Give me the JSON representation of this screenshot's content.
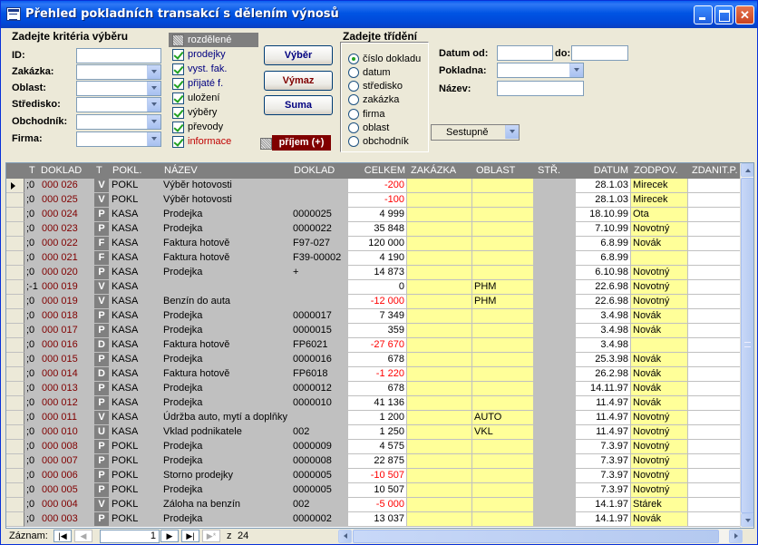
{
  "window": {
    "title": "Přehled pokladních transakcí s dělením výnosů"
  },
  "filters": {
    "title": "Zadejte kritéria výběru",
    "id_label": "ID:",
    "zakazka_label": "Zakázka:",
    "oblast_label": "Oblast:",
    "stredisko_label": "Středisko:",
    "obchodnik_label": "Obchodník:",
    "firma_label": "Firma:"
  },
  "checkboxes": [
    {
      "label": "rozdělené",
      "state": "gray"
    },
    {
      "label": "prodejky",
      "state": "on"
    },
    {
      "label": "vyst. fak.",
      "state": "on"
    },
    {
      "label": "přijaté f.",
      "state": "on"
    },
    {
      "label": "uložení",
      "state": "on"
    },
    {
      "label": "výběry",
      "state": "on"
    },
    {
      "label": "převody",
      "state": "on"
    },
    {
      "label": "informace",
      "state": "on"
    }
  ],
  "buttons": {
    "vyber": "Výběr",
    "vymaz": "Výmaz",
    "suma": "Suma",
    "prijem": "příjem (+)"
  },
  "sorting": {
    "title": "Zadejte třídění",
    "options": [
      "číslo dokladu",
      "datum",
      "středisko",
      "zakázka",
      "firma",
      "oblast",
      "obchodník"
    ],
    "selected_index": 0,
    "direction": "Sestupně"
  },
  "right_filters": {
    "datum_od_label": "Datum od:",
    "do_label": "do:",
    "pokladna_label": "Pokladna:",
    "nazev_label": "Název:"
  },
  "table": {
    "headers": [
      "T",
      "DOKLAD",
      "T",
      "POKL.",
      "NÁZEV",
      "DOKLAD",
      "CELKEM",
      "ZAKÁZKA",
      "OBLAST",
      "STŘ.",
      "DATUM",
      "ZODPOV.",
      "ZDANIT.P."
    ],
    "rows": [
      {
        "t": ";0",
        "doklad": "000 026",
        "typ": "V",
        "pokl": "POKL",
        "nazev": "Výběr hotovosti",
        "doklad2": "",
        "celkem": "-200",
        "neg": true,
        "zakazka": "",
        "oblast": "",
        "datum": "28.1.03",
        "zodpov": "Mirecek"
      },
      {
        "t": ";0",
        "doklad": "000 025",
        "typ": "V",
        "pokl": "POKL",
        "nazev": "Výběr hotovosti",
        "doklad2": "",
        "celkem": "-100",
        "neg": true,
        "zakazka": "",
        "oblast": "",
        "datum": "28.1.03",
        "zodpov": "Mirecek"
      },
      {
        "t": ";0",
        "doklad": "000 024",
        "typ": "P",
        "pokl": "KASA",
        "nazev": "Prodejka",
        "doklad2": "0000025",
        "celkem": "4 999",
        "neg": false,
        "zakazka": "",
        "oblast": "",
        "datum": "18.10.99",
        "zodpov": "Ota"
      },
      {
        "t": ";0",
        "doklad": "000 023",
        "typ": "P",
        "pokl": "KASA",
        "nazev": "Prodejka",
        "doklad2": "0000022",
        "celkem": "35 848",
        "neg": false,
        "zakazka": "",
        "oblast": "",
        "datum": "7.10.99",
        "zodpov": "Novotný"
      },
      {
        "t": ";0",
        "doklad": "000 022",
        "typ": "F",
        "pokl": "KASA",
        "nazev": "Faktura hotově",
        "doklad2": "F97-027",
        "celkem": "120 000",
        "neg": false,
        "zakazka": "",
        "oblast": "",
        "datum": "6.8.99",
        "zodpov": "Novák"
      },
      {
        "t": ";0",
        "doklad": "000 021",
        "typ": "F",
        "pokl": "KASA",
        "nazev": "Faktura hotově",
        "doklad2": "F39-00002",
        "celkem": "4 190",
        "neg": false,
        "zakazka": "",
        "oblast": "",
        "datum": "6.8.99",
        "zodpov": ""
      },
      {
        "t": ";0",
        "doklad": "000 020",
        "typ": "P",
        "pokl": "KASA",
        "nazev": "Prodejka",
        "doklad2": "+",
        "celkem": "14 873",
        "neg": false,
        "zakazka": "",
        "oblast": "",
        "datum": "6.10.98",
        "zodpov": "Novotný"
      },
      {
        "t": ";-1",
        "doklad": "000 019",
        "typ": "V",
        "pokl": "KASA",
        "nazev": "",
        "doklad2": "",
        "celkem": "0",
        "neg": false,
        "zakazka": "",
        "oblast": "PHM",
        "datum": "22.6.98",
        "zodpov": "Novotný"
      },
      {
        "t": ";0",
        "doklad": "000 019",
        "typ": "V",
        "pokl": "KASA",
        "nazev": "Benzín do auta",
        "doklad2": "",
        "celkem": "-12 000",
        "neg": true,
        "zakazka": "",
        "oblast": "PHM",
        "datum": "22.6.98",
        "zodpov": "Novotný"
      },
      {
        "t": ";0",
        "doklad": "000 018",
        "typ": "P",
        "pokl": "KASA",
        "nazev": "Prodejka",
        "doklad2": "0000017",
        "celkem": "7 349",
        "neg": false,
        "zakazka": "",
        "oblast": "",
        "datum": "3.4.98",
        "zodpov": "Novák"
      },
      {
        "t": ";0",
        "doklad": "000 017",
        "typ": "P",
        "pokl": "KASA",
        "nazev": "Prodejka",
        "doklad2": "0000015",
        "celkem": "359",
        "neg": false,
        "zakazka": "",
        "oblast": "",
        "datum": "3.4.98",
        "zodpov": "Novák"
      },
      {
        "t": ";0",
        "doklad": "000 016",
        "typ": "D",
        "pokl": "KASA",
        "nazev": "Faktura  hotově",
        "doklad2": "FP6021",
        "celkem": "-27 670",
        "neg": true,
        "zakazka": "",
        "oblast": "",
        "datum": "3.4.98",
        "zodpov": ""
      },
      {
        "t": ";0",
        "doklad": "000 015",
        "typ": "P",
        "pokl": "KASA",
        "nazev": "Prodejka",
        "doklad2": "0000016",
        "celkem": "678",
        "neg": false,
        "zakazka": "",
        "oblast": "",
        "datum": "25.3.98",
        "zodpov": "Novák"
      },
      {
        "t": ";0",
        "doklad": "000 014",
        "typ": "D",
        "pokl": "KASA",
        "nazev": "Faktura hotově",
        "doklad2": "FP6018",
        "celkem": "-1 220",
        "neg": true,
        "zakazka": "",
        "oblast": "",
        "datum": "26.2.98",
        "zodpov": "Novák"
      },
      {
        "t": ";0",
        "doklad": "000 013",
        "typ": "P",
        "pokl": "KASA",
        "nazev": "Prodejka",
        "doklad2": "0000012",
        "celkem": "678",
        "neg": false,
        "zakazka": "",
        "oblast": "",
        "datum": "14.11.97",
        "zodpov": "Novák"
      },
      {
        "t": ";0",
        "doklad": "000 012",
        "typ": "P",
        "pokl": "KASA",
        "nazev": "Prodejka",
        "doklad2": "0000010",
        "celkem": "41 136",
        "neg": false,
        "zakazka": "",
        "oblast": "",
        "datum": "11.4.97",
        "zodpov": "Novák"
      },
      {
        "t": ";0",
        "doklad": "000 011",
        "typ": "V",
        "pokl": "KASA",
        "nazev": "Údržba auto, mytí a doplňky",
        "doklad2": "",
        "celkem": "1 200",
        "neg": false,
        "zakazka": "",
        "oblast": "AUTO",
        "datum": "11.4.97",
        "zodpov": "Novotný"
      },
      {
        "t": ";0",
        "doklad": "000 010",
        "typ": "U",
        "pokl": "KASA",
        "nazev": "Vklad podnikatele",
        "doklad2": "002",
        "celkem": "1 250",
        "neg": false,
        "zakazka": "",
        "oblast": "VKL",
        "datum": "11.4.97",
        "zodpov": "Novotný"
      },
      {
        "t": ";0",
        "doklad": "000 008",
        "typ": "P",
        "pokl": "POKL",
        "nazev": "Prodejka",
        "doklad2": "0000009",
        "celkem": "4 575",
        "neg": false,
        "zakazka": "",
        "oblast": "",
        "datum": "7.3.97",
        "zodpov": "Novotný"
      },
      {
        "t": ";0",
        "doklad": "000 007",
        "typ": "P",
        "pokl": "POKL",
        "nazev": "Prodejka",
        "doklad2": "0000008",
        "celkem": "22 875",
        "neg": false,
        "zakazka": "",
        "oblast": "",
        "datum": "7.3.97",
        "zodpov": "Novotný"
      },
      {
        "t": ";0",
        "doklad": "000 006",
        "typ": "P",
        "pokl": "POKL",
        "nazev": "Storno prodejky",
        "doklad2": "0000005",
        "celkem": "-10 507",
        "neg": true,
        "zakazka": "",
        "oblast": "",
        "datum": "7.3.97",
        "zodpov": "Novotný"
      },
      {
        "t": ";0",
        "doklad": "000 005",
        "typ": "P",
        "pokl": "POKL",
        "nazev": "Prodejka",
        "doklad2": "0000005",
        "celkem": "10 507",
        "neg": false,
        "zakazka": "",
        "oblast": "",
        "datum": "7.3.97",
        "zodpov": "Novotný"
      },
      {
        "t": ";0",
        "doklad": "000 004",
        "typ": "V",
        "pokl": "POKL",
        "nazev": "Záloha na benzín",
        "doklad2": "002",
        "celkem": "-5 000",
        "neg": true,
        "zakazka": "",
        "oblast": "",
        "datum": "14.1.97",
        "zodpov": "Stárek"
      },
      {
        "t": ";0",
        "doklad": "000 003",
        "typ": "P",
        "pokl": "POKL",
        "nazev": "Prodejka",
        "doklad2": "0000002",
        "celkem": "13 037",
        "neg": false,
        "zakazka": "",
        "oblast": "",
        "datum": "14.1.97",
        "zodpov": "Novák"
      }
    ]
  },
  "navigation": {
    "label": "Záznam:",
    "current": "1",
    "of_label": "z",
    "total": "24"
  },
  "colors": {
    "titlebar": "#0054e3",
    "document_number": "#800000",
    "negative_amount": "#ff0000",
    "highlight_column": "#ffff99",
    "prijem_button": "#800000"
  }
}
